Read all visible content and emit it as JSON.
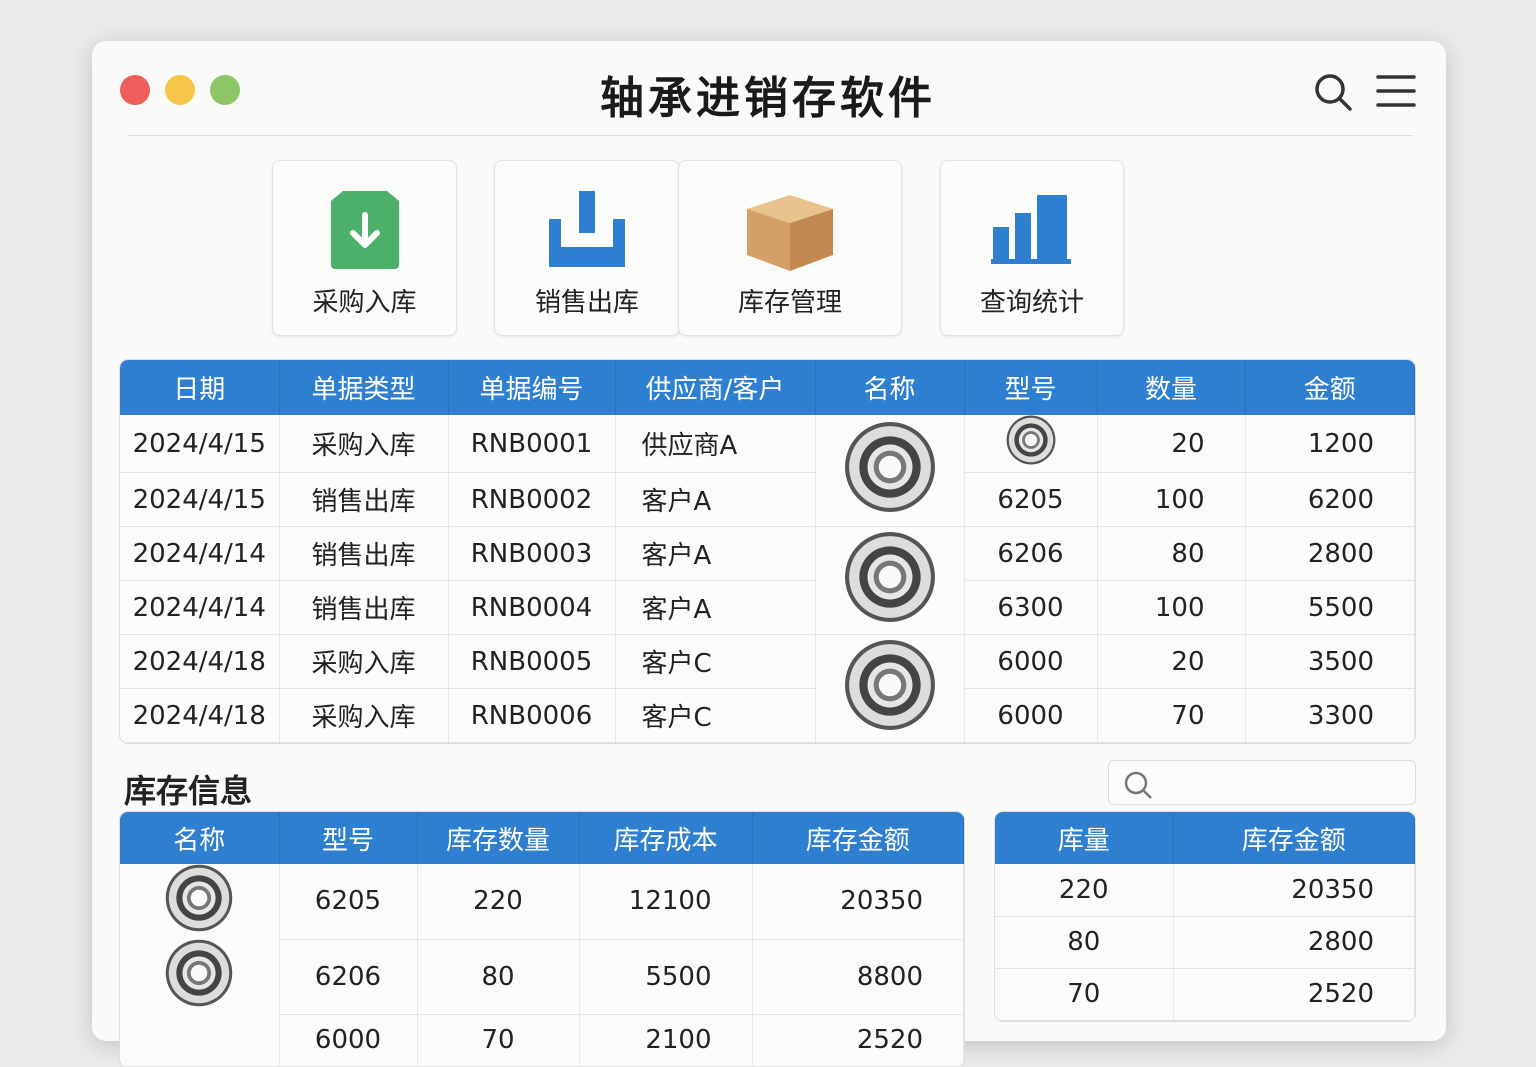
{
  "window": {
    "title": "轴承进销存软件"
  },
  "toolbar": {
    "icons": [
      "search-icon",
      "menu-icon"
    ]
  },
  "tiles": [
    {
      "label": "采购入库",
      "icon": "download-box-icon"
    },
    {
      "label": "销售出库",
      "icon": "upload-tray-icon"
    },
    {
      "label": "库存管理",
      "icon": "cardboard-box-icon"
    },
    {
      "label": "查询统计",
      "icon": "bar-chart-icon"
    }
  ],
  "colors": {
    "accent": "#2f7fd0",
    "green": "#4caf6a"
  },
  "transactions": {
    "headers": [
      "日期",
      "单据类型",
      "单据编号",
      "供应商/客户",
      "名称",
      "型号",
      "数量",
      "金额"
    ],
    "rows": [
      {
        "date": "2024/4/15",
        "type": "采购入库",
        "no": "RNB0001",
        "party": "供应商A",
        "model": "",
        "qty": "20",
        "amount": "1200"
      },
      {
        "date": "2024/4/15",
        "type": "销售出库",
        "no": "RNB0002",
        "party": "客户A",
        "model": "6205",
        "qty": "100",
        "amount": "6200"
      },
      {
        "date": "2024/4/14",
        "type": "销售出库",
        "no": "RNB0003",
        "party": "客户A",
        "model": "6206",
        "qty": "80",
        "amount": "2800"
      },
      {
        "date": "2024/4/14",
        "type": "销售出库",
        "no": "RNB0004",
        "party": "客户A",
        "model": "6300",
        "qty": "100",
        "amount": "5500"
      },
      {
        "date": "2024/4/18",
        "type": "采购入库",
        "no": "RNB0005",
        "party": "客户C",
        "model": "6000",
        "qty": "20",
        "amount": "3500"
      },
      {
        "date": "2024/4/18",
        "type": "采购入库",
        "no": "RNB0006",
        "party": "客户C",
        "model": "6000",
        "qty": "70",
        "amount": "3300"
      }
    ]
  },
  "inventory": {
    "title": "库存信息",
    "search_placeholder": "",
    "headers": [
      "名称",
      "型号",
      "库存数量",
      "库存成本",
      "库存金额"
    ],
    "rows": [
      {
        "model": "6205",
        "qty": "220",
        "cost": "12100",
        "value": "20350"
      },
      {
        "model": "6206",
        "qty": "80",
        "cost": "5500",
        "value": "8800"
      },
      {
        "model": "6000",
        "qty": "70",
        "cost": "2100",
        "value": "2520"
      }
    ],
    "side_headers": [
      "库量",
      "库存金额"
    ],
    "side_rows": [
      [
        "220",
        "20350"
      ],
      [
        "80",
        "2800"
      ],
      [
        "70",
        "2520"
      ]
    ]
  }
}
